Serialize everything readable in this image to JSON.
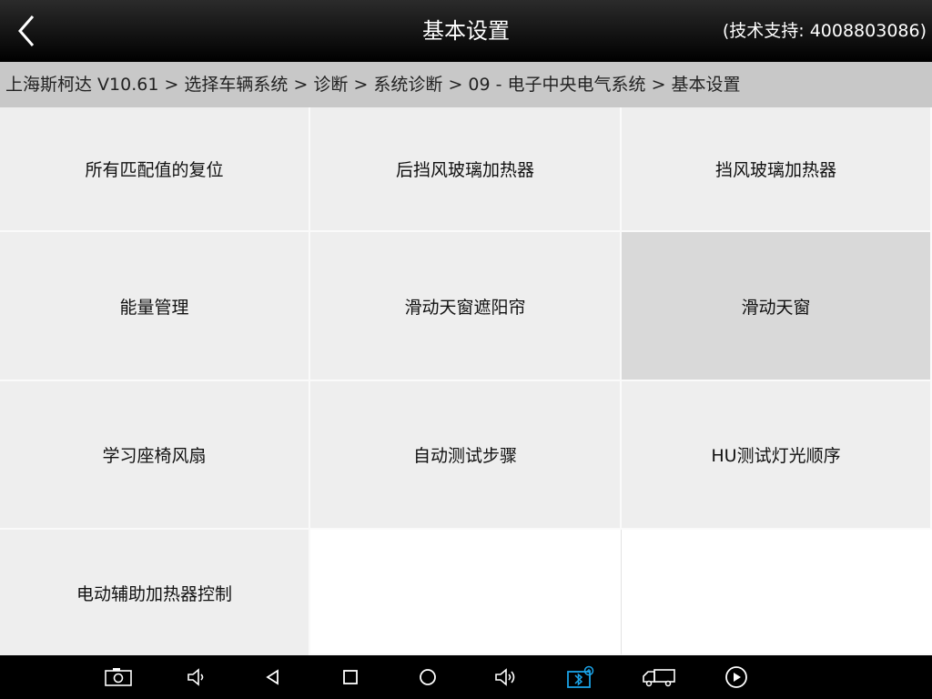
{
  "header": {
    "title": "基本设置",
    "support": "(技术支持: 4008803086)"
  },
  "breadcrumb": "上海斯柯达 V10.61 > 选择车辆系统 > 诊断 > 系统诊断 > 09 - 电子中央电气系统 > 基本设置",
  "grid": {
    "items": [
      "所有匹配值的复位",
      "后挡风玻璃加热器",
      "挡风玻璃加热器",
      "能量管理",
      "滑动天窗遮阳帘",
      "滑动天窗",
      "学习座椅风扇",
      "自动测试步骤",
      "HU测试灯光顺序",
      "电动辅助加热器控制"
    ],
    "selected": "滑动天窗"
  },
  "navbar": {
    "icons": [
      "screenshot-icon",
      "volume-down-icon",
      "back-icon",
      "recent-apps-icon",
      "home-icon",
      "volume-up-icon",
      "vci-bluetooth-icon",
      "truck-icon",
      "play-icon"
    ],
    "accent": "#1aa3e8"
  },
  "colors": {
    "tile": "#eeeeee",
    "tile_selected": "#d9d9d9",
    "breadcrumb_bg": "#c8c8c8"
  }
}
